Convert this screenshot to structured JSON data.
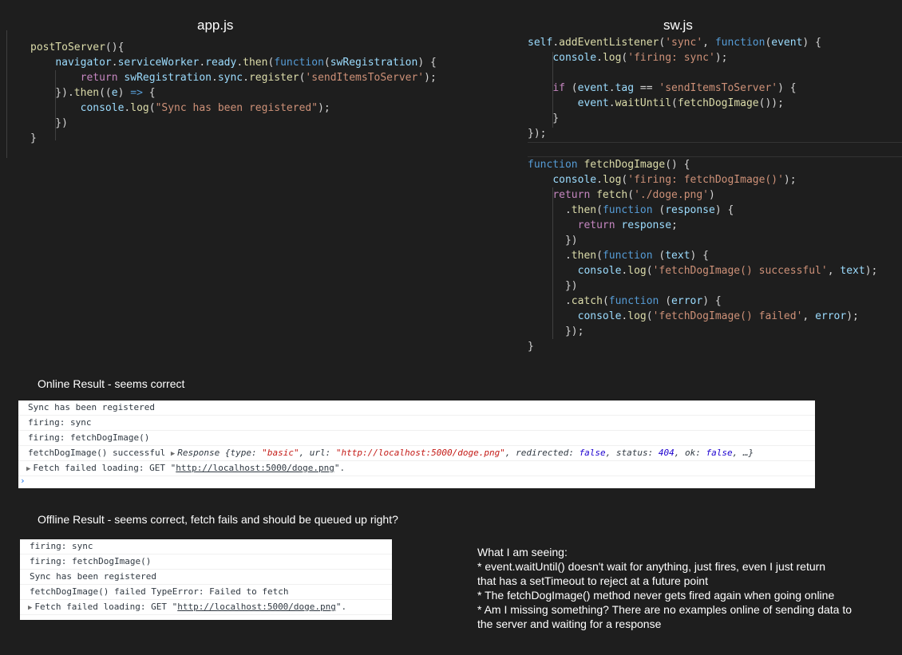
{
  "app_panel": {
    "title": "app.js",
    "lines": [
      [
        {
          "t": "postToServer",
          "c": "fn"
        },
        {
          "t": "(){",
          "c": "pun"
        }
      ],
      [
        {
          "t": "    "
        },
        {
          "t": "navigator",
          "c": "var"
        },
        {
          "t": ".",
          "c": "pun"
        },
        {
          "t": "serviceWorker",
          "c": "var"
        },
        {
          "t": ".",
          "c": "pun"
        },
        {
          "t": "ready",
          "c": "var"
        },
        {
          "t": ".",
          "c": "pun"
        },
        {
          "t": "then",
          "c": "fn"
        },
        {
          "t": "(",
          "c": "pun"
        },
        {
          "t": "function",
          "c": "kw"
        },
        {
          "t": "(",
          "c": "pun"
        },
        {
          "t": "swRegistration",
          "c": "var"
        },
        {
          "t": ") {",
          "c": "pun"
        }
      ],
      [
        {
          "t": "        "
        },
        {
          "t": "return",
          "c": "ctl"
        },
        {
          "t": " "
        },
        {
          "t": "swRegistration",
          "c": "var"
        },
        {
          "t": ".",
          "c": "pun"
        },
        {
          "t": "sync",
          "c": "var"
        },
        {
          "t": ".",
          "c": "pun"
        },
        {
          "t": "register",
          "c": "fn"
        },
        {
          "t": "(",
          "c": "pun"
        },
        {
          "t": "'sendItemsToServer'",
          "c": "str"
        },
        {
          "t": ");",
          "c": "pun"
        }
      ],
      [
        {
          "t": "    }).",
          "c": "pun"
        },
        {
          "t": "then",
          "c": "fn"
        },
        {
          "t": "((",
          "c": "pun"
        },
        {
          "t": "e",
          "c": "var"
        },
        {
          "t": ") ",
          "c": "pun"
        },
        {
          "t": "=>",
          "c": "kw"
        },
        {
          "t": " {",
          "c": "pun"
        }
      ],
      [
        {
          "t": "        "
        },
        {
          "t": "console",
          "c": "var"
        },
        {
          "t": ".",
          "c": "pun"
        },
        {
          "t": "log",
          "c": "fn"
        },
        {
          "t": "(",
          "c": "pun"
        },
        {
          "t": "\"Sync has been registered\"",
          "c": "str"
        },
        {
          "t": ");",
          "c": "pun"
        }
      ],
      [
        {
          "t": "    })",
          "c": "pun"
        }
      ],
      [
        {
          "t": "}",
          "c": "pun"
        }
      ]
    ]
  },
  "sw_panel": {
    "title": "sw.js",
    "block1": [
      [
        {
          "t": "self",
          "c": "var"
        },
        {
          "t": ".",
          "c": "pun"
        },
        {
          "t": "addEventListener",
          "c": "fn"
        },
        {
          "t": "(",
          "c": "pun"
        },
        {
          "t": "'sync'",
          "c": "str"
        },
        {
          "t": ", ",
          "c": "pun"
        },
        {
          "t": "function",
          "c": "kw"
        },
        {
          "t": "(",
          "c": "pun"
        },
        {
          "t": "event",
          "c": "var"
        },
        {
          "t": ") {",
          "c": "pun"
        }
      ],
      [
        {
          "t": "    "
        },
        {
          "t": "console",
          "c": "var"
        },
        {
          "t": ".",
          "c": "pun"
        },
        {
          "t": "log",
          "c": "fn"
        },
        {
          "t": "(",
          "c": "pun"
        },
        {
          "t": "'firing: sync'",
          "c": "str"
        },
        {
          "t": ");",
          "c": "pun"
        }
      ],
      [
        {
          "t": ""
        }
      ],
      [
        {
          "t": "    "
        },
        {
          "t": "if",
          "c": "ctl"
        },
        {
          "t": " (",
          "c": "pun"
        },
        {
          "t": "event",
          "c": "var"
        },
        {
          "t": ".",
          "c": "pun"
        },
        {
          "t": "tag",
          "c": "var"
        },
        {
          "t": " == ",
          "c": "pun"
        },
        {
          "t": "'sendItemsToServer'",
          "c": "str"
        },
        {
          "t": ") {",
          "c": "pun"
        }
      ],
      [
        {
          "t": "        "
        },
        {
          "t": "event",
          "c": "var"
        },
        {
          "t": ".",
          "c": "pun"
        },
        {
          "t": "waitUntil",
          "c": "fn"
        },
        {
          "t": "(",
          "c": "pun"
        },
        {
          "t": "fetchDogImage",
          "c": "fn"
        },
        {
          "t": "());",
          "c": "pun"
        }
      ],
      [
        {
          "t": "    }",
          "c": "pun"
        }
      ],
      [
        {
          "t": "});",
          "c": "pun"
        }
      ]
    ],
    "block2": [
      [
        {
          "t": "function",
          "c": "kw"
        },
        {
          "t": " "
        },
        {
          "t": "fetchDogImage",
          "c": "fn"
        },
        {
          "t": "() {",
          "c": "pun"
        }
      ],
      [
        {
          "t": "    "
        },
        {
          "t": "console",
          "c": "var"
        },
        {
          "t": ".",
          "c": "pun"
        },
        {
          "t": "log",
          "c": "fn"
        },
        {
          "t": "(",
          "c": "pun"
        },
        {
          "t": "'firing: fetchDogImage()'",
          "c": "str"
        },
        {
          "t": ");",
          "c": "pun"
        }
      ],
      [
        {
          "t": "    "
        },
        {
          "t": "return",
          "c": "ctl"
        },
        {
          "t": " "
        },
        {
          "t": "fetch",
          "c": "fn"
        },
        {
          "t": "(",
          "c": "pun"
        },
        {
          "t": "'./doge.png'",
          "c": "str"
        },
        {
          "t": ")",
          "c": "pun"
        }
      ],
      [
        {
          "t": "      ."
        },
        {
          "t": "then",
          "c": "fn"
        },
        {
          "t": "(",
          "c": "pun"
        },
        {
          "t": "function",
          "c": "kw"
        },
        {
          "t": " (",
          "c": "pun"
        },
        {
          "t": "response",
          "c": "var"
        },
        {
          "t": ") {",
          "c": "pun"
        }
      ],
      [
        {
          "t": "        "
        },
        {
          "t": "return",
          "c": "ctl"
        },
        {
          "t": " "
        },
        {
          "t": "response",
          "c": "var"
        },
        {
          "t": ";",
          "c": "pun"
        }
      ],
      [
        {
          "t": "      })",
          "c": "pun"
        }
      ],
      [
        {
          "t": "      ."
        },
        {
          "t": "then",
          "c": "fn"
        },
        {
          "t": "(",
          "c": "pun"
        },
        {
          "t": "function",
          "c": "kw"
        },
        {
          "t": " (",
          "c": "pun"
        },
        {
          "t": "text",
          "c": "var"
        },
        {
          "t": ") {",
          "c": "pun"
        }
      ],
      [
        {
          "t": "        "
        },
        {
          "t": "console",
          "c": "var"
        },
        {
          "t": ".",
          "c": "pun"
        },
        {
          "t": "log",
          "c": "fn"
        },
        {
          "t": "(",
          "c": "pun"
        },
        {
          "t": "'fetchDogImage() successful'",
          "c": "str"
        },
        {
          "t": ", ",
          "c": "pun"
        },
        {
          "t": "text",
          "c": "var"
        },
        {
          "t": ");",
          "c": "pun"
        }
      ],
      [
        {
          "t": "      })",
          "c": "pun"
        }
      ],
      [
        {
          "t": "      ."
        },
        {
          "t": "catch",
          "c": "fn"
        },
        {
          "t": "(",
          "c": "pun"
        },
        {
          "t": "function",
          "c": "kw"
        },
        {
          "t": " (",
          "c": "pun"
        },
        {
          "t": "error",
          "c": "var"
        },
        {
          "t": ") {",
          "c": "pun"
        }
      ],
      [
        {
          "t": "        "
        },
        {
          "t": "console",
          "c": "var"
        },
        {
          "t": ".",
          "c": "pun"
        },
        {
          "t": "log",
          "c": "fn"
        },
        {
          "t": "(",
          "c": "pun"
        },
        {
          "t": "'fetchDogImage() failed'",
          "c": "str"
        },
        {
          "t": ", ",
          "c": "pun"
        },
        {
          "t": "error",
          "c": "var"
        },
        {
          "t": ");",
          "c": "pun"
        }
      ],
      [
        {
          "t": "      });",
          "c": "pun"
        }
      ],
      [
        {
          "t": "}",
          "c": "pun"
        }
      ]
    ]
  },
  "online": {
    "label": "Online Result - seems correct",
    "row1": "Sync has been registered",
    "row2": "firing: sync",
    "row3": "firing: fetchDogImage()",
    "row4": {
      "prefix": "fetchDogImage() successful",
      "obj_open": "Response {type: ",
      "type_val": "\"basic\"",
      "url_key": ", url: ",
      "url_val": "\"http://localhost:5000/doge.png\"",
      "redir_key": ", redirected: ",
      "redir_val": "false",
      "status_key": ", status: ",
      "status_val": "404",
      "ok_key": ", ok: ",
      "ok_val": "false",
      "tail": ", …}"
    },
    "row5": {
      "prefix": "Fetch failed loading: GET \"",
      "link": "http://localhost:5000/doge.png",
      "suffix": "\"."
    },
    "prompt": "›"
  },
  "offline": {
    "label": "Offline Result - seems correct, fetch fails and should be queued up right?",
    "row1": "firing: sync",
    "row2": "firing: fetchDogImage()",
    "row3": "Sync has been registered",
    "row4": "fetchDogImage() failed TypeError: Failed to fetch",
    "row5": {
      "prefix": "Fetch failed loading: GET \"",
      "link": "http://localhost:5000/doge.png",
      "suffix": "\"."
    }
  },
  "notes": [
    "What I am seeing:",
    "* event.waitUntil() doesn't wait for anything, just fires, even I just return",
    "that has a setTimeout to reject at a future point",
    "* The fetchDogImage() method never gets fired again when going online",
    "* Am I missing something? There are no examples online of sending data to",
    "the server and waiting for a response"
  ],
  "colors": {
    "background": "#1e1e1e",
    "keyword": "#569cd6",
    "control": "#c586c0",
    "function": "#dcdcaa",
    "variable": "#9cdcfe",
    "string": "#ce9178"
  }
}
